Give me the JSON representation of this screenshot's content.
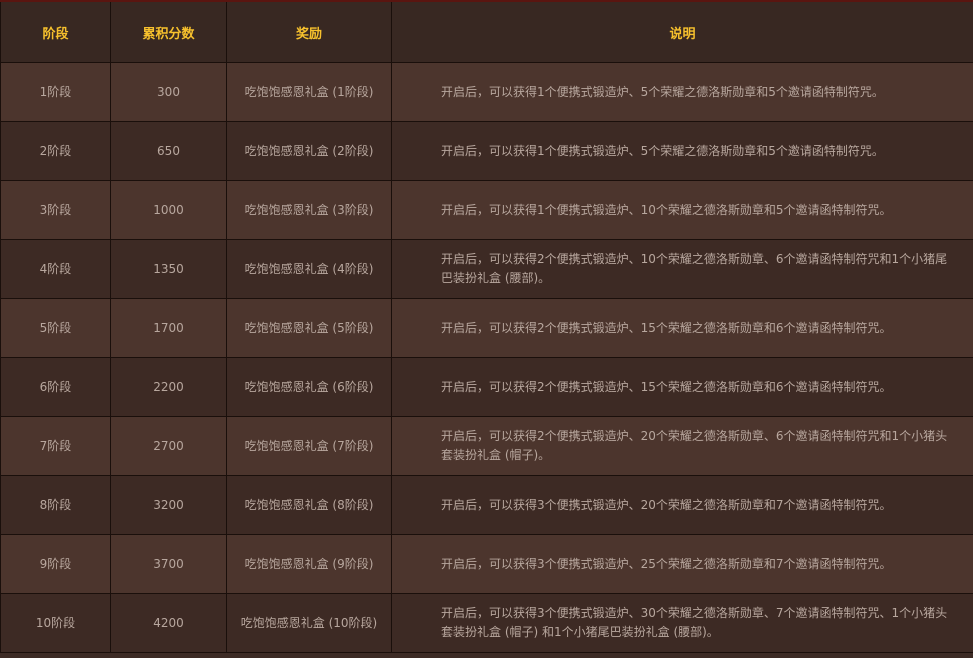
{
  "headers": [
    "阶段",
    "累积分数",
    "奖励",
    "说明"
  ],
  "rows": [
    {
      "stage": "1阶段",
      "score": "300",
      "reward": "吃饱饱感恩礼盒 (1阶段)",
      "desc": "开启后，可以获得1个便携式锻造炉、5个荣耀之德洛斯勋章和5个邀请函特制符咒。"
    },
    {
      "stage": "2阶段",
      "score": "650",
      "reward": "吃饱饱感恩礼盒 (2阶段)",
      "desc": "开启后，可以获得1个便携式锻造炉、5个荣耀之德洛斯勋章和5个邀请函特制符咒。"
    },
    {
      "stage": "3阶段",
      "score": "1000",
      "reward": "吃饱饱感恩礼盒 (3阶段)",
      "desc": "开启后，可以获得1个便携式锻造炉、10个荣耀之德洛斯勋章和5个邀请函特制符咒。"
    },
    {
      "stage": "4阶段",
      "score": "1350",
      "reward": "吃饱饱感恩礼盒 (4阶段)",
      "desc": "开启后，可以获得2个便携式锻造炉、10个荣耀之德洛斯勋章、6个邀请函特制符咒和1个小猪尾巴装扮礼盒 (腰部)。"
    },
    {
      "stage": "5阶段",
      "score": "1700",
      "reward": "吃饱饱感恩礼盒 (5阶段)",
      "desc": "开启后，可以获得2个便携式锻造炉、15个荣耀之德洛斯勋章和6个邀请函特制符咒。"
    },
    {
      "stage": "6阶段",
      "score": "2200",
      "reward": "吃饱饱感恩礼盒 (6阶段)",
      "desc": "开启后，可以获得2个便携式锻造炉、15个荣耀之德洛斯勋章和6个邀请函特制符咒。"
    },
    {
      "stage": "7阶段",
      "score": "2700",
      "reward": "吃饱饱感恩礼盒 (7阶段)",
      "desc": "开启后，可以获得2个便携式锻造炉、20个荣耀之德洛斯勋章、6个邀请函特制符咒和1个小猪头套装扮礼盒 (帽子)。"
    },
    {
      "stage": "8阶段",
      "score": "3200",
      "reward": "吃饱饱感恩礼盒 (8阶段)",
      "desc": "开启后，可以获得3个便携式锻造炉、20个荣耀之德洛斯勋章和7个邀请函特制符咒。"
    },
    {
      "stage": "9阶段",
      "score": "3700",
      "reward": "吃饱饱感恩礼盒 (9阶段)",
      "desc": "开启后，可以获得3个便携式锻造炉、25个荣耀之德洛斯勋章和7个邀请函特制符咒。"
    },
    {
      "stage": "10阶段",
      "score": "4200",
      "reward": "吃饱饱感恩礼盒 (10阶段)",
      "desc": "开启后，可以获得3个便携式锻造炉、30个荣耀之德洛斯勋章、7个邀请函特制符咒、1个小猪头套装扮礼盒 (帽子) 和1个小猪尾巴装扮礼盒 (腰部)。"
    }
  ],
  "colors": {
    "header_text": "#f7c12d",
    "cell_text": "#b8a79e",
    "row_light": "#4c352d",
    "row_dark": "#3d2a24"
  }
}
